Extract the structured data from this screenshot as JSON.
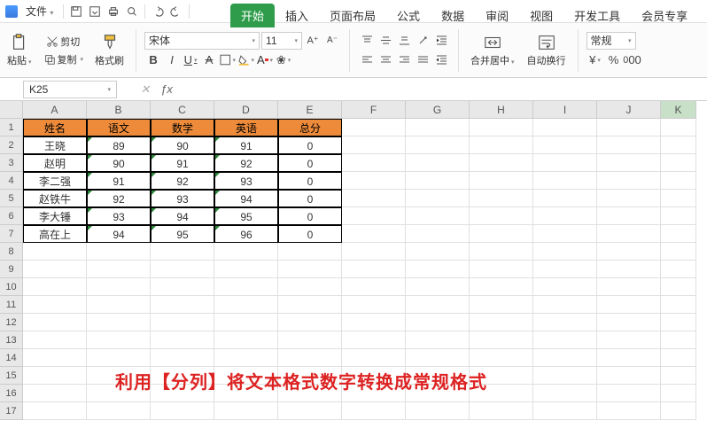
{
  "menubar": {
    "file": "文件"
  },
  "tabs": [
    "开始",
    "插入",
    "页面布局",
    "公式",
    "数据",
    "审阅",
    "视图",
    "开发工具",
    "会员专享"
  ],
  "ribbon": {
    "paste": "粘贴",
    "cut": "剪切",
    "copy": "复制",
    "format_painter": "格式刷",
    "font_name": "宋体",
    "font_size": "11",
    "merge": "合并居中",
    "wrap": "自动换行",
    "num_format": "常规"
  },
  "namebox": "K25",
  "columns": [
    "A",
    "B",
    "C",
    "D",
    "E",
    "F",
    "G",
    "H",
    "I",
    "J",
    "K"
  ],
  "col_widths": [
    "col-A",
    "col-B",
    "col-C",
    "col-D",
    "col-E",
    "col-F",
    "col-G",
    "col-H",
    "col-I",
    "col-J",
    "col-K"
  ],
  "headers": [
    "姓名",
    "语文",
    "数学",
    "英语",
    "总分"
  ],
  "rows": [
    [
      "王晓",
      "89",
      "90",
      "91",
      "0"
    ],
    [
      "赵明",
      "90",
      "91",
      "92",
      "0"
    ],
    [
      "李二强",
      "91",
      "92",
      "93",
      "0"
    ],
    [
      "赵铁牛",
      "92",
      "93",
      "94",
      "0"
    ],
    [
      "李大锤",
      "93",
      "94",
      "95",
      "0"
    ],
    [
      "高在上",
      "94",
      "95",
      "96",
      "0"
    ]
  ],
  "annotation": "利用【分列】将文本格式数字转换成常规格式",
  "chart_data": {
    "type": "table",
    "columns": [
      "姓名",
      "语文",
      "数学",
      "英语",
      "总分"
    ],
    "data": [
      {
        "姓名": "王晓",
        "语文": 89,
        "数学": 90,
        "英语": 91,
        "总分": 0
      },
      {
        "姓名": "赵明",
        "语文": 90,
        "数学": 91,
        "英语": 92,
        "总分": 0
      },
      {
        "姓名": "李二强",
        "语文": 91,
        "数学": 92,
        "英语": 93,
        "总分": 0
      },
      {
        "姓名": "赵铁牛",
        "语文": 92,
        "数学": 93,
        "英语": 94,
        "总分": 0
      },
      {
        "姓名": "李大锤",
        "语文": 93,
        "数学": 94,
        "英语": 95,
        "总分": 0
      },
      {
        "姓名": "高在上",
        "语文": 94,
        "数学": 95,
        "英语": 96,
        "总分": 0
      }
    ]
  }
}
